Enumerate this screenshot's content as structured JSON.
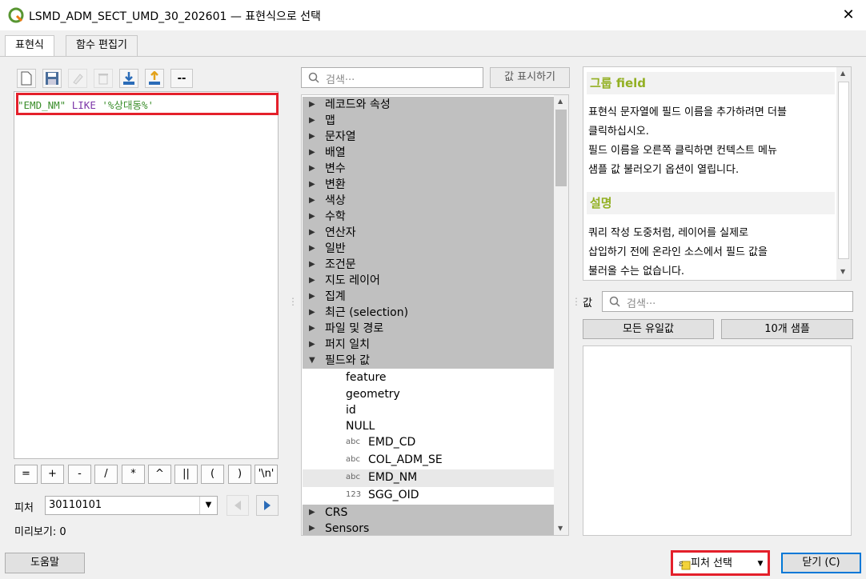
{
  "window": {
    "title": "LSMD_ADM_SECT_UMD_30_202601 — 표현식으로 선택",
    "close_glyph": "✕"
  },
  "tabs": [
    {
      "label": "표현식",
      "active": true
    },
    {
      "label": "함수 편집기",
      "active": false
    }
  ],
  "toolbar": {
    "icons": [
      "new-file-icon",
      "save-icon",
      "edit-icon",
      "delete-icon",
      "import-icon",
      "export-icon",
      "comment-icon"
    ],
    "comment_label": "--"
  },
  "editor": {
    "field": "\"EMD_NM\"",
    "keyword": "LIKE",
    "string": "'%상대동%'"
  },
  "operators": [
    "=",
    "+",
    "-",
    "/",
    "*",
    "^",
    "||",
    "(",
    ")",
    "'\\n'"
  ],
  "feature": {
    "label": "피처",
    "value": "30110101"
  },
  "preview": {
    "text": "미리보기:  0"
  },
  "middle": {
    "search_placeholder": "검색···",
    "show_values_label": "값 표시하기",
    "groups": [
      "레코드와 속성",
      "맵",
      "문자열",
      "배열",
      "변수",
      "변환",
      "색상",
      "수학",
      "연산자",
      "일반",
      "조건문",
      "지도 레이어",
      "집계",
      "최근 (selection)",
      "파일 및 경로",
      "퍼지 일치",
      "필드와 값"
    ],
    "field_children": [
      {
        "type": "",
        "name": "feature"
      },
      {
        "type": "",
        "name": "geometry"
      },
      {
        "type": "",
        "name": "id"
      },
      {
        "type": "",
        "name": "NULL"
      },
      {
        "type": "abc",
        "name": "EMD_CD"
      },
      {
        "type": "abc",
        "name": "COL_ADM_SE"
      },
      {
        "type": "abc",
        "name": "EMD_NM"
      },
      {
        "type": "123",
        "name": "SGG_OID"
      }
    ],
    "after_groups": [
      "CRS",
      "Sensors"
    ]
  },
  "help": {
    "heading1": "그룹 field",
    "p1_lines": [
      "표현식 문자열에 필드 이름을 추가하려면 더블",
      "클릭하십시오.",
      "필드 이름을 오른쪽 클릭하면 컨텍스트 메뉴",
      "샘플 값 불러오기 옵션이 열립니다."
    ],
    "heading2": "설명",
    "p2_lines": [
      "쿼리 작성 도중처럼, 레이어를 실제로",
      "삽입하기 전에 온라인 소스에서 필드 값을",
      "불러올 수는 없습니다."
    ]
  },
  "values": {
    "label": "값",
    "search_placeholder": "검색···",
    "all_unique_label": "모든 유일값",
    "sample_label": "10개 샘플"
  },
  "bottom": {
    "help_label": "도움말",
    "select_label": "피처 선택",
    "close_label": "닫기 (C)"
  },
  "colors": {
    "highlight_red": "#e4202b",
    "qgis_green": "#93b023"
  }
}
